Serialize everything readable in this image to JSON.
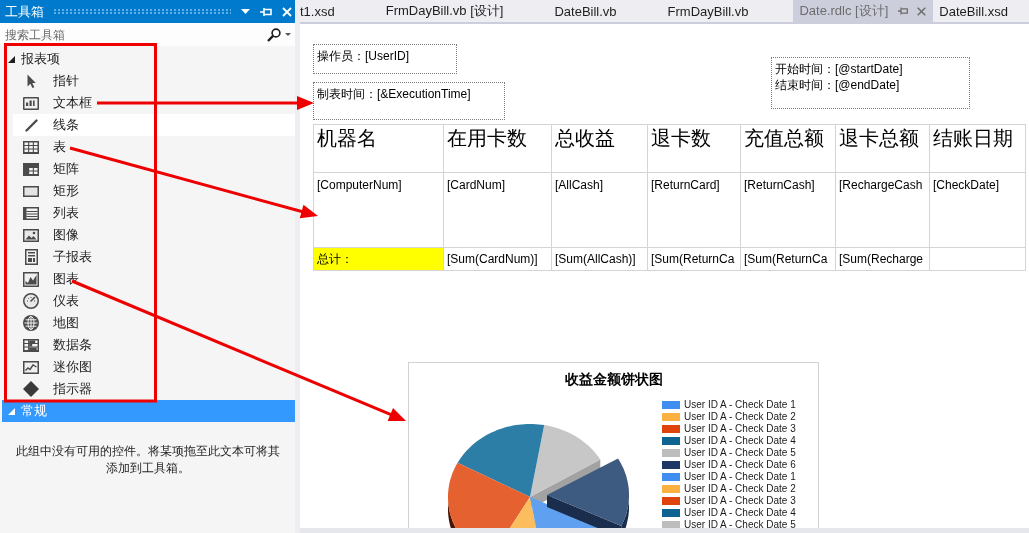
{
  "toolbox": {
    "title": "工具箱",
    "search": {
      "placeholder": "搜索工具箱"
    },
    "groups": [
      {
        "label": "报表项",
        "expanded": true,
        "selected": false,
        "items": [
          {
            "label": "指针",
            "kind": "pointer",
            "selected": false
          },
          {
            "label": "文本框",
            "kind": "textbox",
            "selected": false
          },
          {
            "label": "线条",
            "kind": "line",
            "selected": true
          },
          {
            "label": "表",
            "kind": "table",
            "selected": false
          },
          {
            "label": "矩阵",
            "kind": "matrix",
            "selected": false
          },
          {
            "label": "矩形",
            "kind": "rectangle",
            "selected": false
          },
          {
            "label": "列表",
            "kind": "list",
            "selected": false
          },
          {
            "label": "图像",
            "kind": "image",
            "selected": false
          },
          {
            "label": "子报表",
            "kind": "subreport",
            "selected": false
          },
          {
            "label": "图表",
            "kind": "chart",
            "selected": false
          },
          {
            "label": "仪表",
            "kind": "gauge",
            "selected": false
          },
          {
            "label": "地图",
            "kind": "map",
            "selected": false
          },
          {
            "label": "数据条",
            "kind": "databar",
            "selected": false
          },
          {
            "label": "迷你图",
            "kind": "sparkline",
            "selected": false
          },
          {
            "label": "指示器",
            "kind": "indicator",
            "selected": false
          }
        ]
      },
      {
        "label": "常规",
        "expanded": true,
        "selected": true,
        "message": "此组中没有可用的控件。将某项拖至此文本可将其添加到工具箱。"
      }
    ]
  },
  "tabs": [
    {
      "label": "t1.xsd",
      "selected": false
    },
    {
      "label": "FrmDayBill.vb [设计]",
      "selected": false
    },
    {
      "label": "DateBill.vb",
      "selected": false
    },
    {
      "label": "FrmDayBill.vb",
      "selected": false
    },
    {
      "label": "Date.rdlc [设计]",
      "selected": true
    },
    {
      "label": "DateBill.xsd",
      "selected": false
    }
  ],
  "report": {
    "textboxes": [
      {
        "lines": [
          "操作员：[UserID]"
        ]
      },
      {
        "lines": [
          "制表时间：[&ExecutionTime]"
        ]
      },
      {
        "lines": [
          "开始时间：[@startDate]",
          "结束时间：[@endDate]"
        ]
      }
    ],
    "table": {
      "columns": [
        "机器名",
        "在用卡数",
        "总收益",
        "退卡数",
        "充值总额",
        "退卡总额",
        "结账日期"
      ],
      "rows": [
        {
          "kind": "detail",
          "cells": [
            "[ComputerNum]",
            "[CardNum]",
            "[AllCash]",
            "[ReturnCard]",
            "[ReturnCash]",
            "[RechargeCash",
            "[CheckDate]"
          ]
        },
        {
          "kind": "total",
          "cells": [
            "总计：",
            "[Sum(CardNum)]",
            "[Sum(AllCash)]",
            "[Sum(ReturnCa",
            "[Sum(ReturnCa",
            "[Sum(Recharge"
          ]
        }
      ]
    },
    "chart": {
      "title": "收益金额饼状图",
      "legend": [
        {
          "label": "User ID A - Check Date 1",
          "color": "#3f8ef0"
        },
        {
          "label": "User ID A - Check Date 2",
          "color": "#fbb040"
        },
        {
          "label": "User ID A - Check Date 3",
          "color": "#e0440c"
        },
        {
          "label": "User ID A - Check Date 4",
          "color": "#0d6490"
        },
        {
          "label": "User ID A - Check Date 5",
          "color": "#bdbdbd"
        },
        {
          "label": "User ID A - Check Date 6",
          "color": "#1c3766"
        },
        {
          "label": "User ID A - Check Date 1",
          "color": "#3f8ef0"
        },
        {
          "label": "User ID A - Check Date 2",
          "color": "#fbb040"
        },
        {
          "label": "User ID A - Check Date 3",
          "color": "#e0440c"
        },
        {
          "label": "User ID A - Check Date 4",
          "color": "#0d6490"
        },
        {
          "label": "User ID A - Check Date 5",
          "color": "#bdbdbd"
        }
      ]
    }
  }
}
